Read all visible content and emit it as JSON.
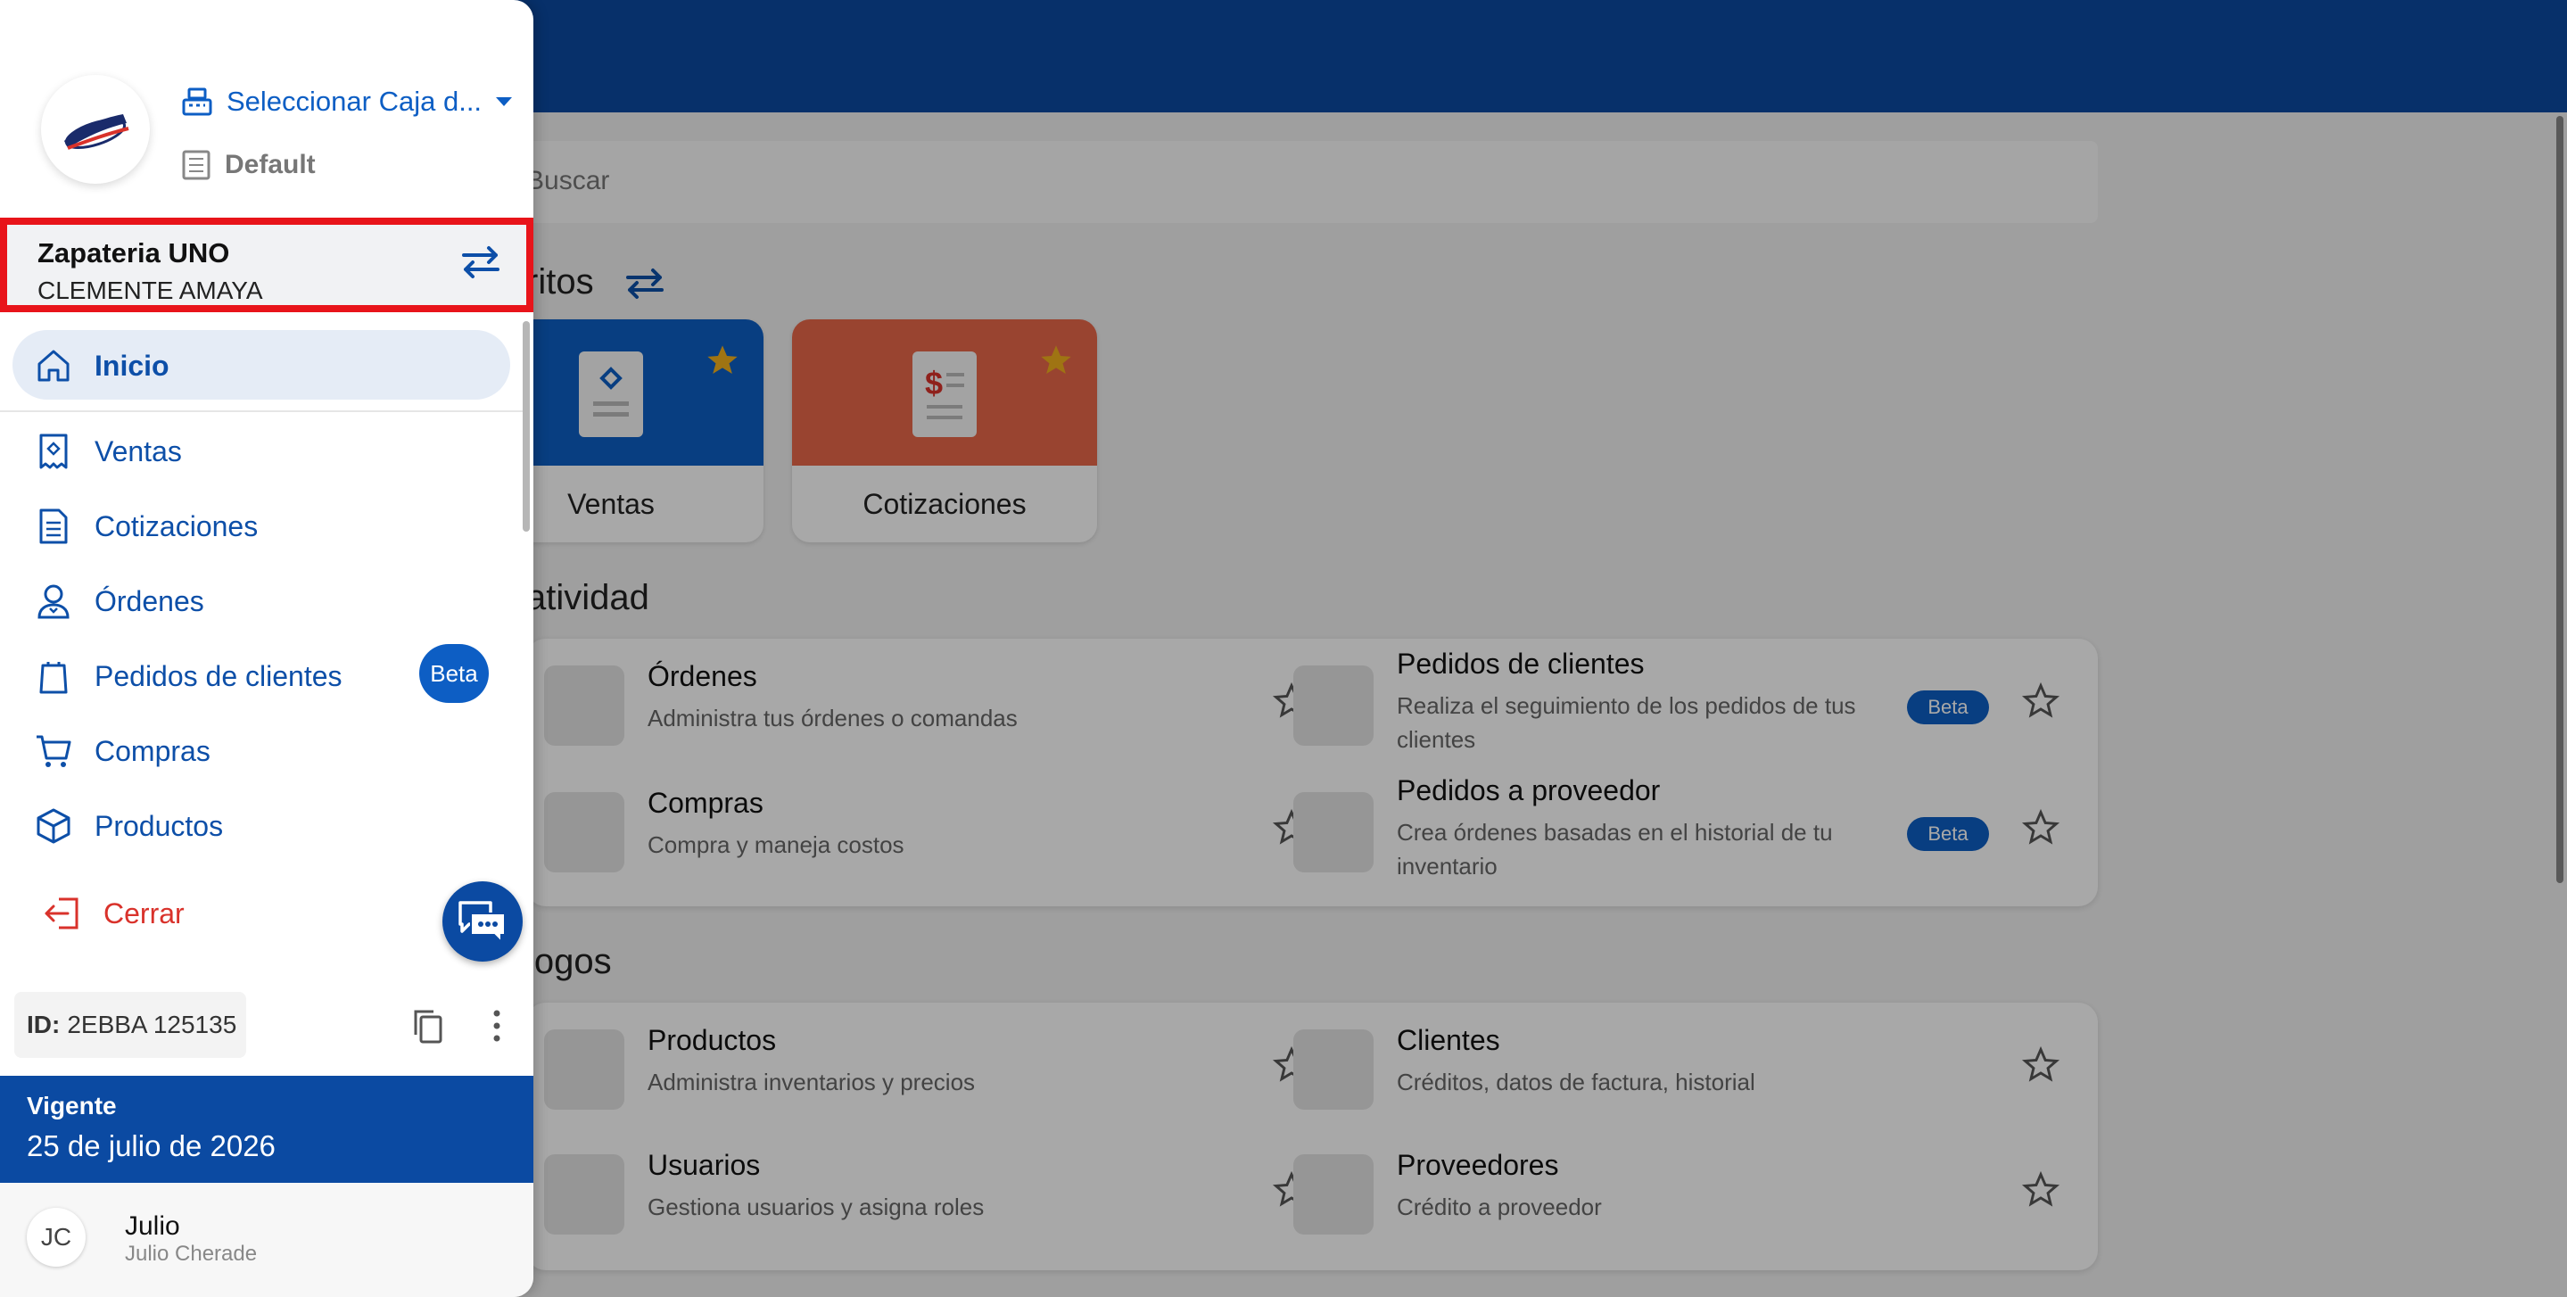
{
  "drawer": {
    "caja_label": "Seleccionar Caja d...",
    "branch_label": "Default",
    "store_name": "Zapateria UNO",
    "store_user": "CLEMENTE AMAYA",
    "nav": {
      "inicio": "Inicio",
      "ventas": "Ventas",
      "cotizaciones": "Cotizaciones",
      "ordenes": "Órdenes",
      "pedidos_clientes": "Pedidos de clientes",
      "compras": "Compras",
      "productos": "Productos"
    },
    "beta_label": "Beta",
    "logout_label": "Cerrar",
    "id_label": "ID:",
    "id_value": "2EBBA 125135",
    "validity_label": "Vigente",
    "validity_date": "25 de julio de 2026",
    "user_initials": "JC",
    "user_name": "Julio",
    "user_full": "Julio Cherade"
  },
  "main": {
    "search_placeholder": "Buscar",
    "favorites_title": "ritos",
    "favorites": [
      {
        "label": "Ventas",
        "color": "#0d5ec4"
      },
      {
        "label": "Cotizaciones",
        "color": "#e8684a"
      }
    ],
    "productivity_title": "atividad",
    "productivity": [
      {
        "title": "Órdenes",
        "desc": "Administra tus órdenes o comandas"
      },
      {
        "title": "Pedidos de clientes",
        "desc": "Realiza el seguimiento de los pedidos de tus clientes",
        "badge": "Beta"
      },
      {
        "title": "Compras",
        "desc": "Compra y maneja costos"
      },
      {
        "title": "Pedidos a proveedor",
        "desc": "Crea órdenes basadas en el historial de tu inventario",
        "badge": "Beta"
      }
    ],
    "catalogs_title": "logos",
    "catalogs": [
      {
        "title": "Productos",
        "desc": "Administra inventarios y precios"
      },
      {
        "title": "Clientes",
        "desc": "Créditos, datos de factura, historial"
      },
      {
        "title": "Usuarios",
        "desc": "Gestiona usuarios y asigna roles"
      },
      {
        "title": "Proveedores",
        "desc": "Crédito a proveedor"
      }
    ]
  },
  "colors": {
    "primary": "#0b4aa2",
    "accent": "#0d5ec4",
    "danger": "#d9322b",
    "highlight": "#e8141a",
    "star": "#f2b01e"
  }
}
